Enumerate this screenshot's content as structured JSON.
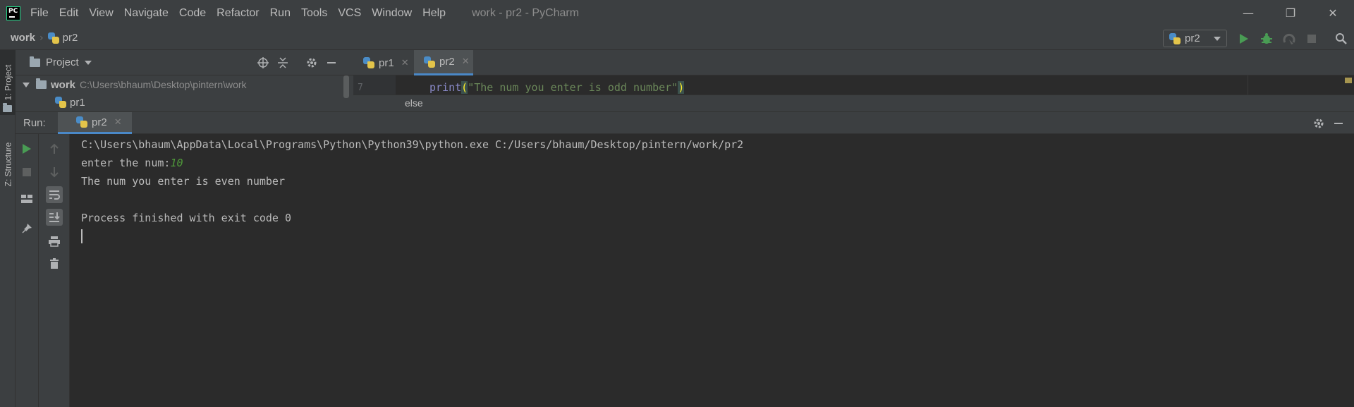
{
  "app": {
    "window_title": "work - pr2 - PyCharm",
    "menu": [
      "File",
      "Edit",
      "View",
      "Navigate",
      "Code",
      "Refactor",
      "Run",
      "Tools",
      "VCS",
      "Window",
      "Help"
    ],
    "window_controls": {
      "minimize": "—",
      "restore": "❐",
      "close": "✕"
    }
  },
  "navbar": {
    "root": "work",
    "file": "pr2",
    "run_config": "pr2"
  },
  "left_strip": {
    "project_tab": "1: Project",
    "structure_tab": "Z: Structure"
  },
  "project": {
    "title": "Project",
    "root_name": "work",
    "root_path": "C:\\Users\\bhaum\\Desktop\\pintern\\work",
    "child": "pr1"
  },
  "editor": {
    "tabs": [
      {
        "name": "pr1",
        "active": false
      },
      {
        "name": "pr2",
        "active": true
      }
    ],
    "line_number": "7",
    "code_func": "print",
    "code_string": "\"The num you enter is odd number\"",
    "breadcrumb": "else"
  },
  "run": {
    "label": "Run:",
    "tab": "pr2",
    "console": {
      "command": "C:\\Users\\bhaum\\AppData\\Local\\Programs\\Python\\Python39\\python.exe C:/Users/bhaum/Desktop/pintern/work/pr2",
      "prompt": "enter the num:",
      "user_input": "10",
      "output": "The num you enter is even number",
      "exit": "Process finished with exit code 0"
    }
  },
  "colors": {
    "background": "#2b2b2b",
    "panel": "#3c3f41",
    "accent": "#4a88c7",
    "run_green": "#499c54",
    "user_input": "#4f9a3a"
  }
}
